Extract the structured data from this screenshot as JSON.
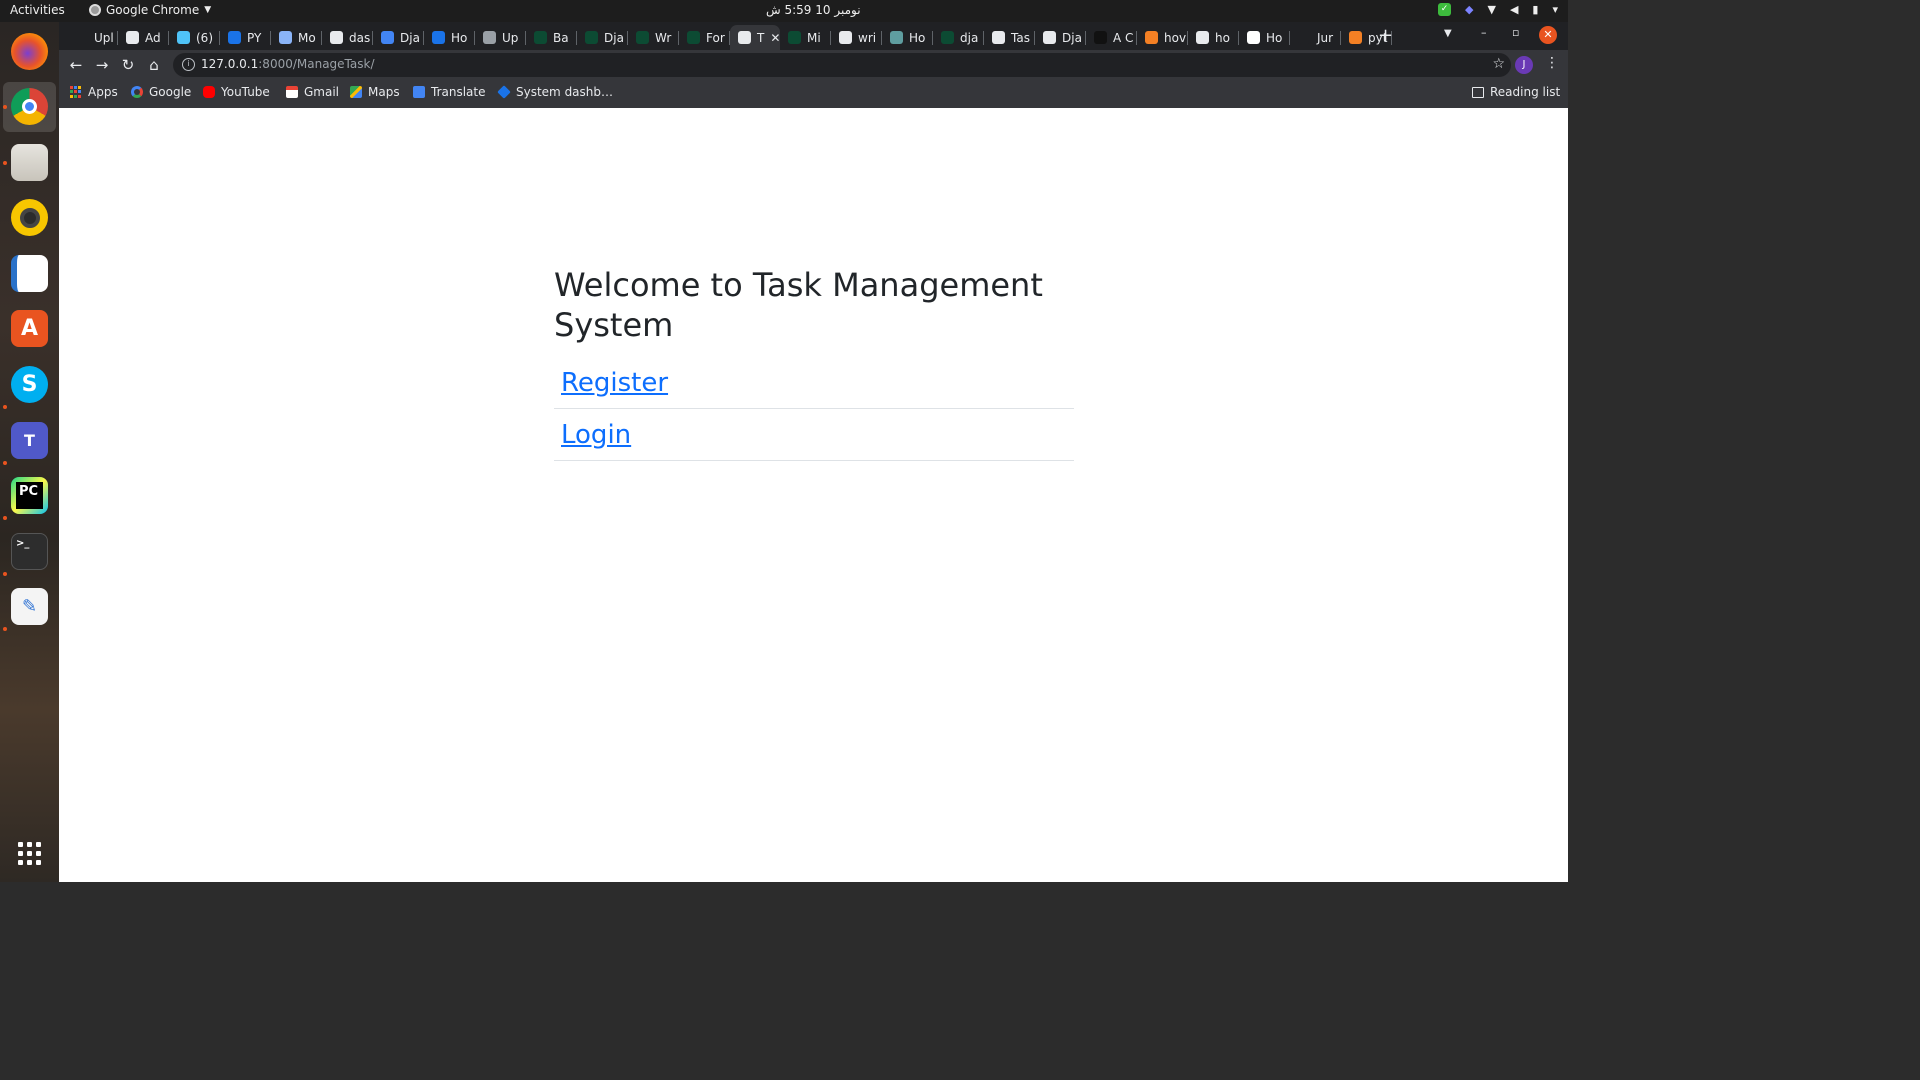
{
  "topbar": {
    "activities": "Activities",
    "app_name": "Google Chrome",
    "clock": "نومبر 10  5:59 ش"
  },
  "dock": {
    "items": [
      {
        "name": "firefox-icon",
        "label": "Firefox"
      },
      {
        "name": "chrome-icon",
        "label": "Google Chrome"
      },
      {
        "name": "files-icon",
        "label": "Files"
      },
      {
        "name": "rhythmbox-icon",
        "label": "Rhythmbox"
      },
      {
        "name": "writer-icon",
        "label": "LibreOffice Writer"
      },
      {
        "name": "software-icon",
        "label": "Ubuntu Software"
      },
      {
        "name": "skype-icon",
        "label": "Skype"
      },
      {
        "name": "teams-icon",
        "label": "Microsoft Teams"
      },
      {
        "name": "pycharm-icon",
        "label": "PyCharm"
      },
      {
        "name": "terminal-icon",
        "label": "Terminal"
      },
      {
        "name": "text-editor-icon",
        "label": "Text Editor"
      },
      {
        "name": "show-apps-icon",
        "label": "Show Applications"
      }
    ]
  },
  "tabs": [
    {
      "title": "Upl",
      "color": "#202124"
    },
    {
      "title": "Ad",
      "color": "#e8eaed"
    },
    {
      "title": "(6)",
      "color": "#4fc3f7"
    },
    {
      "title": "PY",
      "color": "#1a73e8"
    },
    {
      "title": "Mo",
      "color": "#8ab4f8"
    },
    {
      "title": "das",
      "color": "#e8eaed"
    },
    {
      "title": "Dja",
      "color": "#4285f4"
    },
    {
      "title": "Ho",
      "color": "#1a73e8"
    },
    {
      "title": "Up",
      "color": "#9aa0a6"
    },
    {
      "title": "Ba",
      "color": "#0c4b33"
    },
    {
      "title": "Dja",
      "color": "#0c4b33"
    },
    {
      "title": "Wr",
      "color": "#0c4b33"
    },
    {
      "title": "For",
      "color": "#0c4b33"
    },
    {
      "title": "T",
      "color": "#e8eaed",
      "active": true
    },
    {
      "title": "Mi",
      "color": "#0c4b33"
    },
    {
      "title": "wri",
      "color": "#e8eaed"
    },
    {
      "title": "Ho",
      "color": "#5f9ea0"
    },
    {
      "title": "dja",
      "color": "#0c4b33"
    },
    {
      "title": "Tas",
      "color": "#e8eaed"
    },
    {
      "title": "Dja",
      "color": "#e8eaed"
    },
    {
      "title": "A C",
      "color": "#111111"
    },
    {
      "title": "hov",
      "color": "#f48024"
    },
    {
      "title": "ho",
      "color": "#e8eaed"
    },
    {
      "title": "Ho",
      "color": "#ffffff"
    },
    {
      "title": "Jur",
      "color": "#202124"
    },
    {
      "title": "pyt",
      "color": "#f48024"
    }
  ],
  "toolbar": {
    "url_host": "127.0.0.1",
    "url_rest": ":8000/ManageTask/",
    "avatar_letter": "J"
  },
  "bookmarks": [
    {
      "label": "Apps",
      "icon": "apps-grid-icon"
    },
    {
      "label": "Google",
      "icon": "google-icon",
      "color": "#4285f4"
    },
    {
      "label": "YouTube",
      "icon": "youtube-icon",
      "color": "#ff0000"
    },
    {
      "label": "Gmail",
      "icon": "gmail-icon",
      "color": "#ea4335"
    },
    {
      "label": "Maps",
      "icon": "maps-icon",
      "color": "#34a853"
    },
    {
      "label": "Translate",
      "icon": "translate-icon",
      "color": "#4285f4"
    },
    {
      "label": "System dashb…",
      "icon": "dashboard-icon",
      "color": "#1a73e8"
    }
  ],
  "reading_list": "Reading list",
  "page": {
    "title": "Welcome to Task Management System",
    "links": [
      {
        "label": "Register"
      },
      {
        "label": "Login"
      }
    ]
  }
}
